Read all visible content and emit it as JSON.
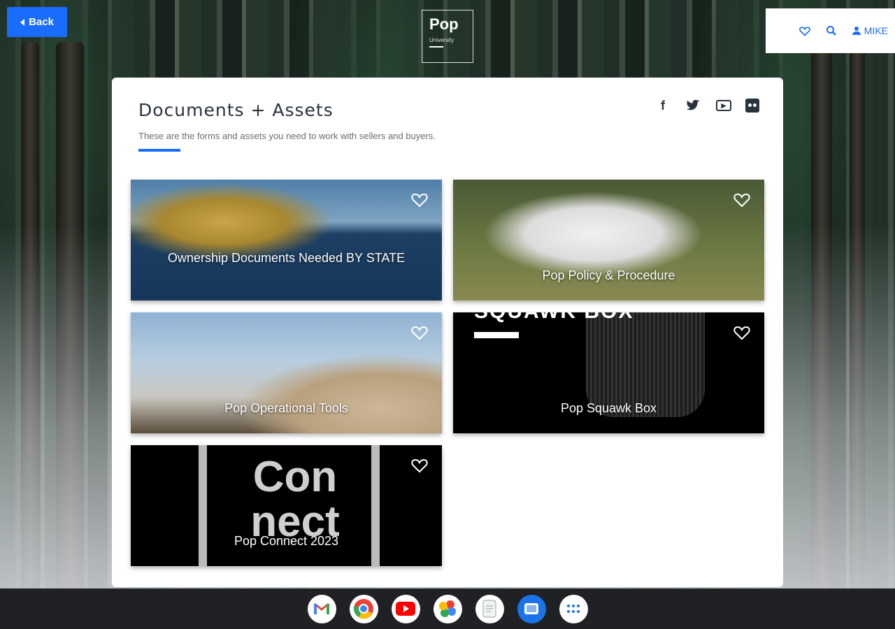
{
  "nav": {
    "back_label": "Back",
    "logo_title": "Pop",
    "logo_subtitle": "University",
    "user_label": "MIKE"
  },
  "page": {
    "title": "Documents + Assets",
    "subtitle": "These are the forms and assets you need to work with sellers and buyers."
  },
  "social": [
    "facebook-icon",
    "twitter-icon",
    "youtube-icon",
    "flickr-icon"
  ],
  "cards": [
    {
      "title": "Ownership Documents Needed BY STATE"
    },
    {
      "title": "Pop Policy & Procedure"
    },
    {
      "title": "Pop Operational Tools"
    },
    {
      "title": "Pop Squawk Box",
      "image_text": "SQUAWK BOX"
    },
    {
      "title": "Pop Connect 2023",
      "image_text": "Con nect"
    }
  ],
  "shelf": [
    "gmail-icon",
    "chrome-icon",
    "youtube-icon",
    "photos-icon",
    "files-icon",
    "messages-icon",
    "app-launcher-icon"
  ],
  "colors": {
    "accent": "#1a6cff",
    "text_dark": "#2b3340",
    "shelf": "#202124"
  }
}
